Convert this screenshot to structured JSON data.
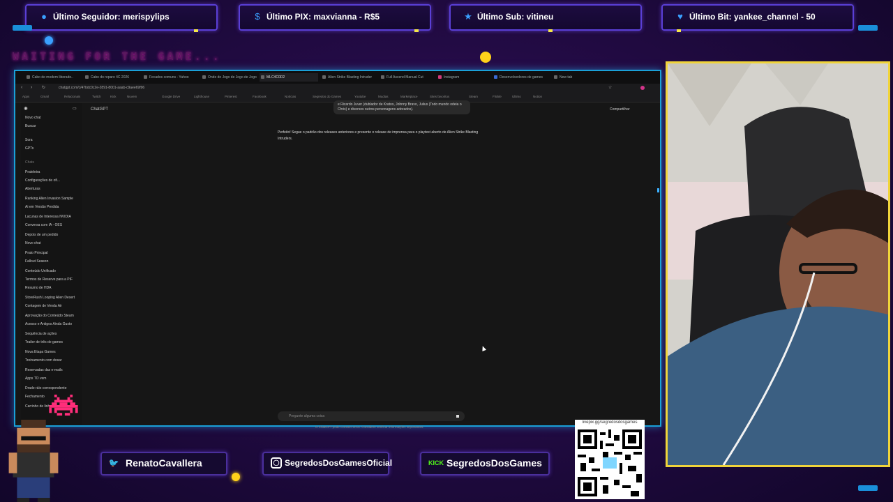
{
  "alerts": [
    {
      "icon": "user-icon",
      "label": "Último Seguidor: merispylips"
    },
    {
      "icon": "dollar-icon",
      "label": "Último PIX: maxvianna - R$5"
    },
    {
      "icon": "star-icon",
      "label": "Último Sub: vitineu"
    },
    {
      "icon": "heart-icon",
      "label": "Último Bit: yankee_channel - 50"
    }
  ],
  "waiting_text": "WAITING FOR THE GAME...",
  "browser": {
    "tabs": [
      "Cabo de modem liberado..",
      "Cabo do reparo 4C 2026",
      "Fecados comuns - Yahoo",
      "Onde do Jogo de Jogo de Jogo",
      "MLC4C0D2",
      "Alien Strike Blasting Intruder",
      "Full Ascend Manual Cut",
      "Instagram",
      "Desenvolvedores de games",
      "New tab"
    ],
    "url": "chatgpt.com/c/47bdc0c2e-2891-8001-aaab-c9aee69f96",
    "bookmarks": [
      "Apps",
      "Gmail",
      "Relacionais",
      "Twitch",
      "Kick",
      "Nuvem",
      "Google Drive",
      "Lighthouse",
      "Pinterest",
      "Facebook",
      "Notícias",
      "Segredos do Games",
      "Youtube",
      "Mudias",
      "Marketplace",
      "Sites favoritos",
      "Steam",
      "Flickle",
      "Ultimo",
      "Notion"
    ],
    "sidebar": [
      "Novo chat",
      "Buscar",
      "Sora",
      "GPTs",
      "Chats",
      "Prateleira",
      "Configurações de ofi...",
      "Aberturas",
      "Ranking Alien Invasion Sample",
      "Ai em Versão Perdida",
      "Lacunas de Interessa NVIDIA",
      "Conversa com IA - OES",
      "Depois de um pedido",
      "Novo chat",
      "Prato Principal",
      "Fallout Season",
      "Conteúdo Unificado",
      "Termos de Reserve para a PIF",
      "Resumo de HDA",
      "StoreRush Looping Alien Desert",
      "Contagem de Venda Air",
      "Aprovação do Conteúdo Steam",
      "Acesso e Antigos Ainda Gusto",
      "Sequência de ações",
      "Trailer de três de games",
      "Nova Etapa Games",
      "Treinamento com dosar",
      "Reservadas das e-mails",
      "Apps TO vem",
      "Drade ráio correspondente",
      "Fechamento",
      "Carrinho de linha"
    ],
    "chat_title": "ChatGPT",
    "share_label": "Compartilhar",
    "bubble_text": "e Ricardo Juver (dublador de Kratos, Johnny Bravo, Julius (Todo mundo odeia o Chris) e diversos outros personagens adorados).",
    "reply_text": "Perfeito! Segue o padrão dos releases anteriores e presente o release de imprensa para o playtest aberto de Alien Strike Blasting Intruders.",
    "composer_placeholder": "Pergunte alguma coisa",
    "disclaimer": "O ChatGPT pode cometer erros. Considere verificar informações importantes."
  },
  "social": [
    {
      "icon": "twitter-icon",
      "label": "RenatoCavallera"
    },
    {
      "icon": "instagram-icon",
      "label": "SegredosDosGamesOficial"
    },
    {
      "icon": "kick-icon",
      "badge": "KICK",
      "label": "SegredosDosGames"
    }
  ],
  "qr_url": "livepix.gg/segredosdosgames",
  "colors": {
    "accent": "#1aa0d8",
    "frame_cam": "#f0d43a",
    "alert_border": "#5a3fd6",
    "background": "#230b45"
  }
}
